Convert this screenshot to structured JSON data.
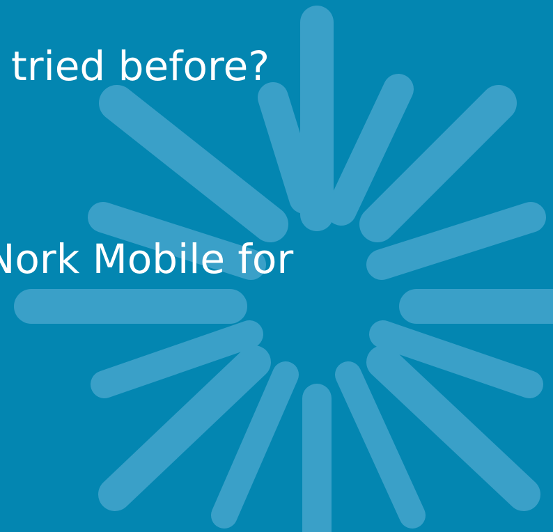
{
  "colors": {
    "background": "#0386b1",
    "ray": "#3aa0c8",
    "text": "#ffffff"
  },
  "slide": {
    "lines": [
      "tried before?",
      "Nork Mobile for"
    ]
  },
  "graphic": {
    "name": "starburst",
    "ray_count": 16
  }
}
